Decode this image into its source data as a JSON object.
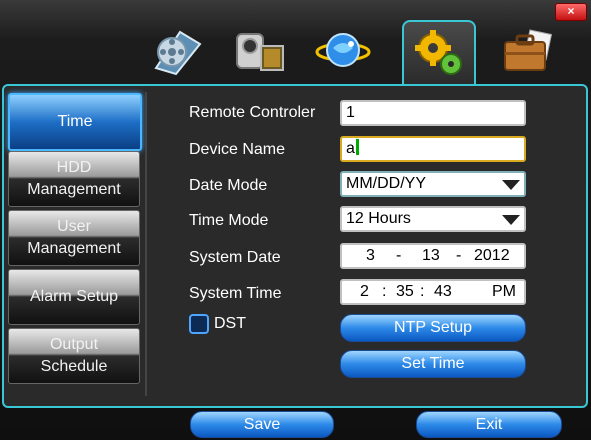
{
  "window": {
    "close_glyph": "×"
  },
  "tabs": [
    {
      "icon": "film-reel-icon"
    },
    {
      "icon": "camera-icon"
    },
    {
      "icon": "network-globe-icon"
    },
    {
      "icon": "gears-icon",
      "active": true
    },
    {
      "icon": "briefcase-icon"
    }
  ],
  "sidebar": {
    "items": [
      {
        "label": "Time",
        "active": true
      },
      {
        "label1": "HDD",
        "label2": "Management"
      },
      {
        "label1": "User",
        "label2": "Management"
      },
      {
        "label": "Alarm Setup"
      },
      {
        "label1": "Output",
        "label2": "Schedule"
      }
    ]
  },
  "form": {
    "remote_controller": {
      "label": "Remote Controler",
      "value": "1"
    },
    "device_name": {
      "label": "Device Name",
      "value": "a"
    },
    "date_mode": {
      "label": "Date Mode",
      "value": "MM/DD/YY"
    },
    "time_mode": {
      "label": "Time Mode",
      "value": "12 Hours"
    },
    "system_date": {
      "label": "System Date",
      "month": "3",
      "sep1": "-",
      "day": "13",
      "sep2": "-",
      "year": "2012"
    },
    "system_time": {
      "label": "System Time",
      "hour": "2",
      "sep1": ":",
      "minute": "35",
      "sep2": ":",
      "second": "43",
      "ampm": "PM"
    },
    "dst": {
      "label": "DST",
      "checked": false
    },
    "ntp_button": "NTP Setup",
    "set_time_button": "Set Time"
  },
  "footer": {
    "save": "Save",
    "exit": "Exit"
  },
  "colors": {
    "accent": "#39c7d6",
    "button_blue": "#2d8ae8",
    "focus": "#d9a920"
  }
}
